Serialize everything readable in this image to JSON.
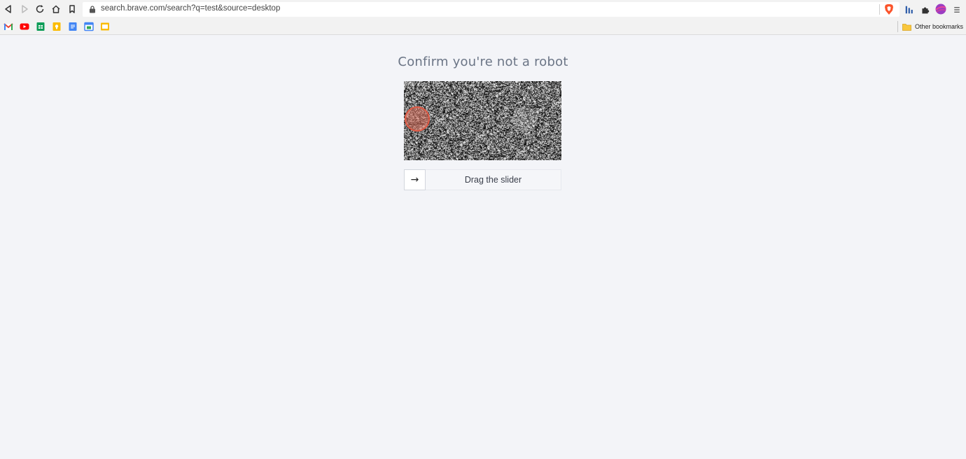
{
  "browser": {
    "url": "search.brave.com/search?q=test&source=desktop",
    "other_bookmarks_label": "Other bookmarks"
  },
  "bookmarks": [
    "gmail-icon",
    "youtube-icon",
    "sheets-icon",
    "keep-icon",
    "docs-icon",
    "calendar-icon",
    "slides-icon"
  ],
  "page": {
    "title": "Confirm you're not a robot",
    "slider_label": "Drag the slider",
    "slider_arrow": "→"
  },
  "colors": {
    "page_bg": "#f3f4f8",
    "title": "#6b7586",
    "target_circle": "#e05a45"
  }
}
